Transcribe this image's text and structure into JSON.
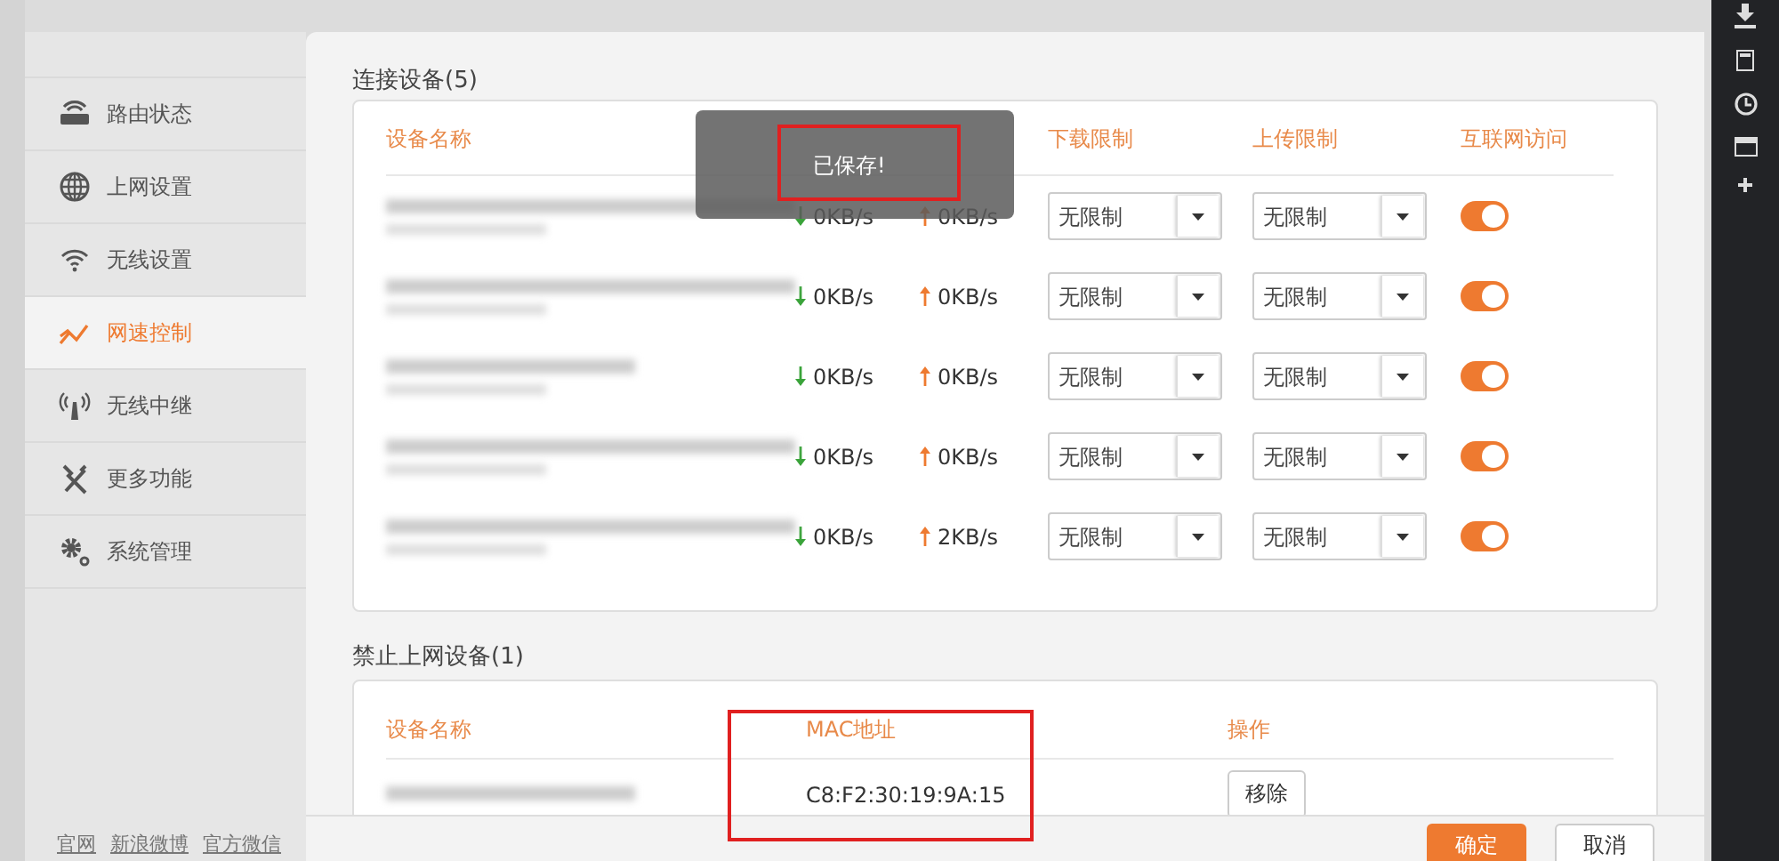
{
  "sidebar": {
    "items": [
      {
        "label": "路由状态",
        "selected": false
      },
      {
        "label": "上网设置",
        "selected": false
      },
      {
        "label": "无线设置",
        "selected": false
      },
      {
        "label": "网速控制",
        "selected": true
      },
      {
        "label": "无线中继",
        "selected": false
      },
      {
        "label": "更多功能",
        "selected": false
      },
      {
        "label": "系统管理",
        "selected": false
      }
    ],
    "footer_links": [
      "官网",
      "新浪微博",
      "官方微信"
    ]
  },
  "connected": {
    "title": "连接设备(5)",
    "columns": [
      "设备名称",
      "下载限制",
      "上传限制",
      "互联网访问"
    ],
    "rows": [
      {
        "download": "0KB/s",
        "upload": "0KB/s",
        "download_limit": "无限制",
        "upload_limit": "无限制",
        "internet": true
      },
      {
        "download": "0KB/s",
        "upload": "0KB/s",
        "download_limit": "无限制",
        "upload_limit": "无限制",
        "internet": true
      },
      {
        "download": "0KB/s",
        "upload": "0KB/s",
        "download_limit": "无限制",
        "upload_limit": "无限制",
        "internet": true
      },
      {
        "download": "0KB/s",
        "upload": "0KB/s",
        "download_limit": "无限制",
        "upload_limit": "无限制",
        "internet": true
      },
      {
        "download": "0KB/s",
        "upload": "2KB/s",
        "download_limit": "无限制",
        "upload_limit": "无限制",
        "internet": true
      }
    ]
  },
  "blocked": {
    "title": "禁止上网设备(1)",
    "columns": [
      "设备名称",
      "MAC地址",
      "操作"
    ],
    "rows": [
      {
        "mac": "C8:F2:30:19:9A:15",
        "action": "移除"
      }
    ]
  },
  "toast": {
    "text": "已保存!"
  },
  "buttons": {
    "confirm": "确定",
    "cancel": "取消"
  }
}
